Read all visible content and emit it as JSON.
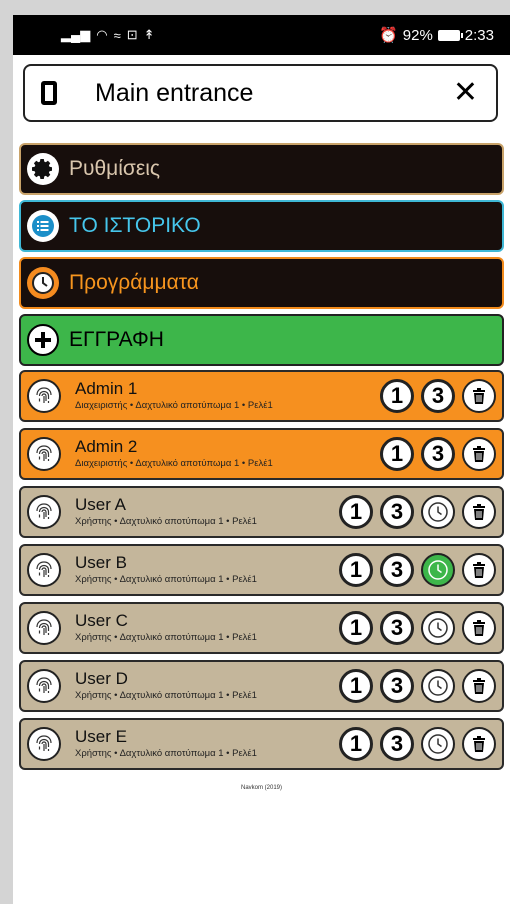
{
  "status": {
    "battery": "92%",
    "time": "2:33"
  },
  "header": {
    "title": "Main entrance"
  },
  "menu": {
    "settings": "Ρυθμίσεις",
    "history": "ΤΟ ΙΣΤΟΡΙΚΟ",
    "programs": "Προγράμματα",
    "register": "ΕΓΓΡΑΦΗ"
  },
  "users": [
    {
      "name": "Admin 1",
      "sub": "Διαχειριστής • Δαχτυλικό αποτύπωμα 1 • Ρελέ1",
      "role": "admin",
      "btn1": "1",
      "btn3": "3"
    },
    {
      "name": "Admin 2",
      "sub": "Διαχειριστής • Δαχτυλικό αποτύπωμα 1 • Ρελέ1",
      "role": "admin",
      "btn1": "1",
      "btn3": "3"
    },
    {
      "name": "User A",
      "sub": "Χρήστης • Δαχτυλικό αποτύπωμα 1 • Ρελέ1",
      "role": "user",
      "btn1": "1",
      "btn3": "3",
      "schedule_active": false
    },
    {
      "name": "User B",
      "sub": "Χρήστης • Δαχτυλικό αποτύπωμα 1 • Ρελέ1",
      "role": "user",
      "btn1": "1",
      "btn3": "3",
      "schedule_active": true
    },
    {
      "name": "User C",
      "sub": "Χρήστης • Δαχτυλικό αποτύπωμα 1 • Ρελέ1",
      "role": "user",
      "btn1": "1",
      "btn3": "3",
      "schedule_active": false
    },
    {
      "name": "User D",
      "sub": "Χρήστης • Δαχτυλικό αποτύπωμα 1 • Ρελέ1",
      "role": "user",
      "btn1": "1",
      "btn3": "3",
      "schedule_active": false
    },
    {
      "name": "User E",
      "sub": "Χρήστης • Δαχτυλικό αποτύπωμα 1 • Ρελέ1",
      "role": "user",
      "btn1": "1",
      "btn3": "3",
      "schedule_active": false
    }
  ],
  "footer": "Navkom (2019)",
  "colors": {
    "admin": "#f6901f",
    "user": "#c4b69b",
    "active_schedule": "#3db64a"
  }
}
